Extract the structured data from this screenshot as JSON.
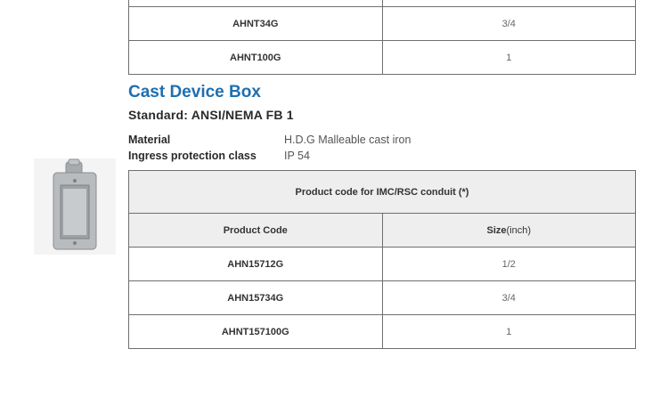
{
  "top_table": {
    "rows": [
      {
        "code": "",
        "size": ""
      },
      {
        "code": "AHNT34G",
        "size": "3/4"
      },
      {
        "code": "AHNT100G",
        "size": "1"
      }
    ]
  },
  "section": {
    "title": "Cast Device Box",
    "standard": "Standard: ANSI/NEMA FB 1",
    "specs": [
      {
        "label": "Material",
        "value": "H.D.G Malleable cast iron"
      },
      {
        "label": "Ingress protection class",
        "value": "IP 54"
      }
    ]
  },
  "main_table": {
    "caption": "Product code for IMC/RSC conduit (*)",
    "col_code": "Product Code",
    "col_size_bold": "Size",
    "col_size_unit": "(inch)",
    "rows": [
      {
        "code": "AHN15712G",
        "size": "1/2"
      },
      {
        "code": "AHN15734G",
        "size": "3/4"
      },
      {
        "code": "AHNT157100G",
        "size": "1"
      }
    ]
  },
  "product_image": {
    "icon": "cast-device-box-photo",
    "color": "#b9bcbf"
  }
}
